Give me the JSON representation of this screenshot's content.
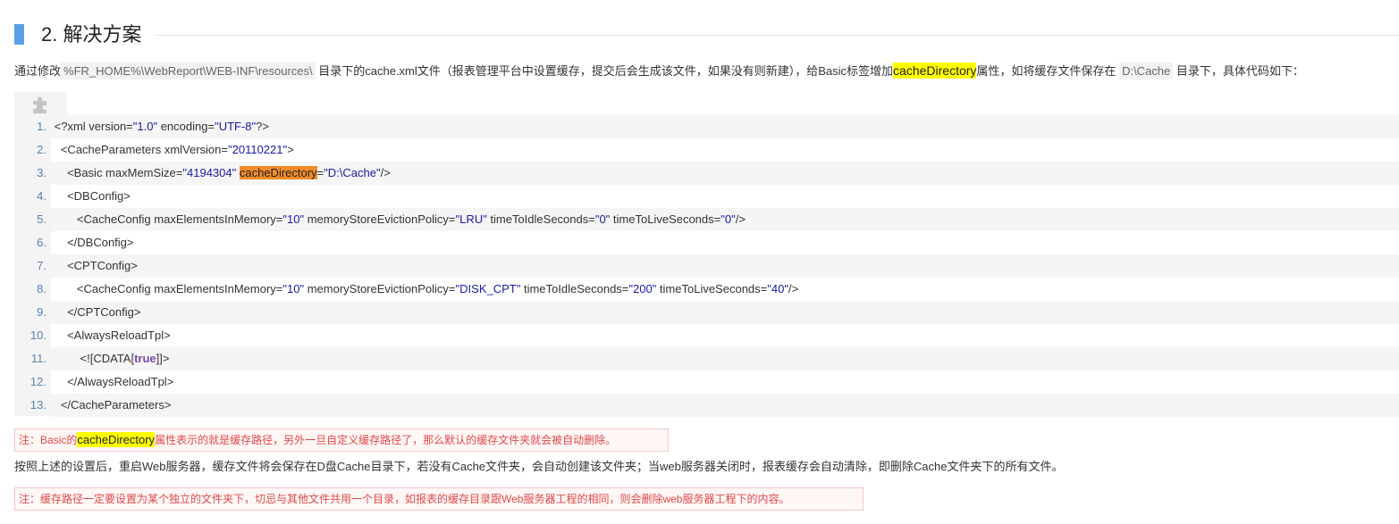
{
  "heading": {
    "title": "2. 解决方案"
  },
  "intro": {
    "t1": "通过修改",
    "path1": "%FR_HOME%\\WebReport\\WEB-INF\\resources\\",
    "t2": " 目录下的cache.xml文件（报表管理平台中设置缓存，提交后会生成该文件，如果没有则新建），给Basic标签增加",
    "hl": "cacheDirectory",
    "t3": "属性，如将缓存文件保存在",
    "path2": "D:\\Cache",
    "t4": " 目录下，具体代码如下："
  },
  "code": {
    "icon": "plugin-icon",
    "lines": [
      {
        "n": "1.",
        "indent": "",
        "parts": [
          [
            "t",
            "<?xml version="
          ],
          [
            "s",
            "\"1.0\""
          ],
          [
            "t",
            " encoding="
          ],
          [
            "s",
            "\"UTF-8\""
          ],
          [
            "t",
            "?>"
          ]
        ]
      },
      {
        "n": "2.",
        "indent": "  ",
        "parts": [
          [
            "t",
            "<CacheParameters xmlVersion="
          ],
          [
            "s",
            "\"20110221\""
          ],
          [
            "t",
            ">"
          ]
        ]
      },
      {
        "n": "3.",
        "indent": "    ",
        "parts": [
          [
            "t",
            "<Basic maxMemSize="
          ],
          [
            "s",
            "\"4194304\""
          ],
          [
            "t",
            " "
          ],
          [
            "h",
            "cacheDirectory"
          ],
          [
            "t",
            "="
          ],
          [
            "s",
            "\"D:\\Cache\""
          ],
          [
            "t",
            "/>"
          ]
        ]
      },
      {
        "n": "4.",
        "indent": "    ",
        "parts": [
          [
            "t",
            "<DBConfig>"
          ]
        ]
      },
      {
        "n": "5.",
        "indent": "       ",
        "parts": [
          [
            "t",
            "<CacheConfig maxElementsInMemory="
          ],
          [
            "s",
            "\"10\""
          ],
          [
            "t",
            " memoryStoreEvictionPolicy="
          ],
          [
            "s",
            "\"LRU\""
          ],
          [
            "t",
            " timeToIdleSeconds="
          ],
          [
            "s",
            "\"0\""
          ],
          [
            "t",
            " timeToLiveSeconds="
          ],
          [
            "s",
            "\"0\""
          ],
          [
            "t",
            "/>"
          ]
        ]
      },
      {
        "n": "6.",
        "indent": "    ",
        "parts": [
          [
            "t",
            "</DBConfig>"
          ]
        ]
      },
      {
        "n": "7.",
        "indent": "    ",
        "parts": [
          [
            "t",
            "<CPTConfig>"
          ]
        ]
      },
      {
        "n": "8.",
        "indent": "       ",
        "parts": [
          [
            "t",
            "<CacheConfig maxElementsInMemory="
          ],
          [
            "s",
            "\"10\""
          ],
          [
            "t",
            " memoryStoreEvictionPolicy="
          ],
          [
            "s",
            "\"DISK_CPT\""
          ],
          [
            "t",
            " timeToIdleSeconds="
          ],
          [
            "s",
            "\"200\""
          ],
          [
            "t",
            " timeToLiveSeconds="
          ],
          [
            "s",
            "\"40\""
          ],
          [
            "t",
            "/>"
          ]
        ]
      },
      {
        "n": "9.",
        "indent": "    ",
        "parts": [
          [
            "t",
            "</CPTConfig>"
          ]
        ]
      },
      {
        "n": "10.",
        "indent": "    ",
        "parts": [
          [
            "t",
            "<AlwaysReloadTpl>"
          ]
        ]
      },
      {
        "n": "11.",
        "indent": "        ",
        "parts": [
          [
            "t",
            "<![CDATA["
          ],
          [
            "k",
            "true"
          ],
          [
            "t",
            "]]>"
          ]
        ]
      },
      {
        "n": "12.",
        "indent": "    ",
        "parts": [
          [
            "t",
            "</AlwaysReloadTpl>"
          ]
        ]
      },
      {
        "n": "13.",
        "indent": "  ",
        "parts": [
          [
            "t",
            "</CacheParameters>"
          ]
        ]
      }
    ]
  },
  "note1": {
    "t1": "注：Basic的",
    "hl": "cacheDirectory",
    "t2": "属性表示的就是缓存路径，另外一旦自定义缓存路径了，那么默认的缓存文件夹就会被自动删除。"
  },
  "para2": {
    "text": "按照上述的设置后，重启Web服务器，缓存文件将会保存在D盘Cache目录下，若没有Cache文件夹，会自动创建该文件夹；当web服务器关闭时，报表缓存会自动清除，即删除Cache文件夹下的所有文件。"
  },
  "note2": {
    "text": "注：缓存路径一定要设置为某个独立的文件夹下，切忌与其他文件共用一个目录，如报表的缓存目录跟Web服务器工程的相同，则会删除web服务器工程下的内容。"
  },
  "colors": {
    "heading_bar": "#5aa0e6",
    "highlight": "#ffff00",
    "code_highlight": "#f28c28",
    "string": "#1a1aa6",
    "note_text": "#e04a4a"
  }
}
